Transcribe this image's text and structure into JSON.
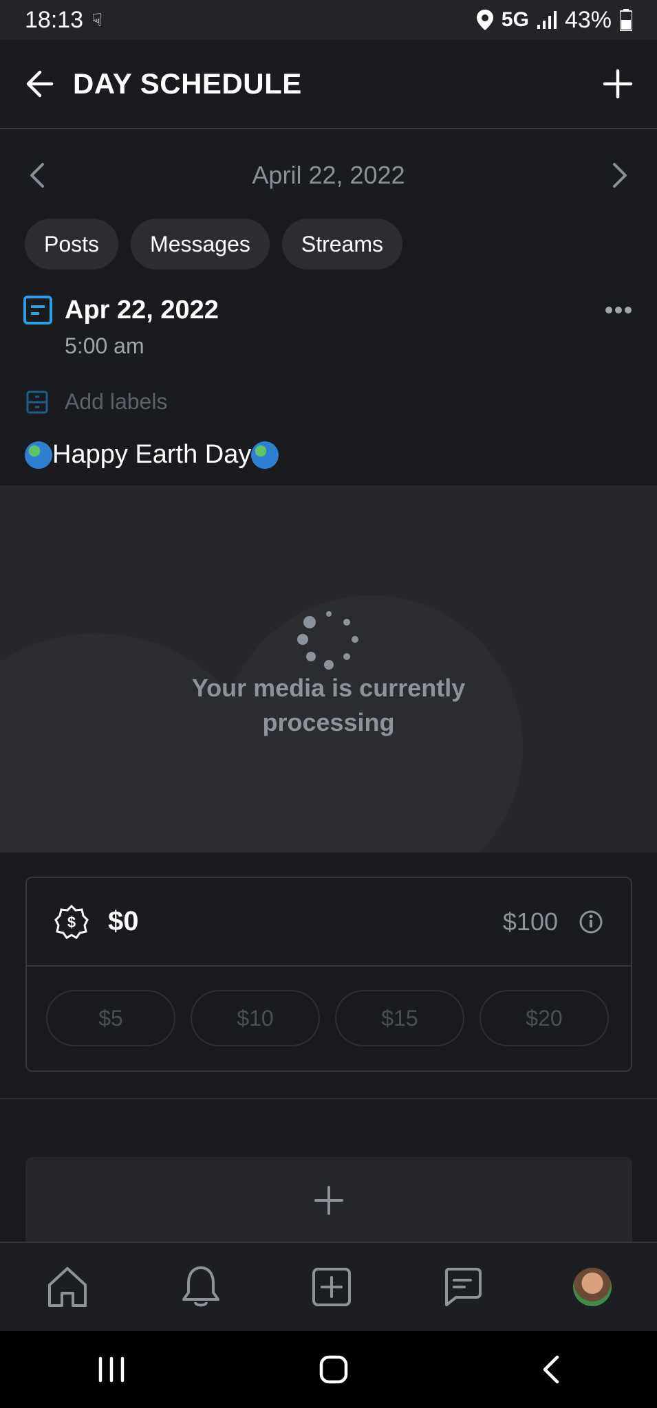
{
  "status_bar": {
    "time": "18:13",
    "network": "5G",
    "battery": "43%"
  },
  "header": {
    "title": "DAY SCHEDULE"
  },
  "date_nav": {
    "date": "April 22, 2022"
  },
  "filters": [
    "Posts",
    "Messages",
    "Streams"
  ],
  "post": {
    "date": "Apr 22, 2022",
    "time": "5:00 am",
    "add_labels": "Add labels",
    "text": "Happy Earth Day"
  },
  "media": {
    "message_line1": "Your media is currently",
    "message_line2": "processing"
  },
  "tips": {
    "amount": "$0",
    "max": "$100",
    "options": [
      "$5",
      "$10",
      "$15",
      "$20"
    ]
  },
  "colors": {
    "accent": "#2e9fe3",
    "background": "#1a1b1e",
    "muted": "#8d939b"
  }
}
